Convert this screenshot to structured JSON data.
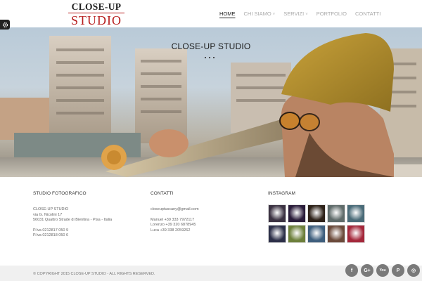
{
  "brand": {
    "logo_top": "CLOSE-UP",
    "logo_bottom": "STUDIO",
    "accent": "#b71c1c"
  },
  "nav": {
    "items": [
      {
        "label": "HOME",
        "active": true
      },
      {
        "label": "CHI SIAMO",
        "caret": "˅"
      },
      {
        "label": "SERVIZI",
        "caret": "˅"
      },
      {
        "label": "PORTFOLIO"
      },
      {
        "label": "CONTATTI"
      }
    ]
  },
  "hero": {
    "title": "CLOSE-UP STUDIO"
  },
  "footer": {
    "studio": {
      "title": "STUDIO FOTOGRAFICO",
      "lines": [
        "CLOSE-UP STUDIO",
        "via G. Nicolini 17",
        "56031 Quattro Strade di Bientina - Pisa - Italia"
      ],
      "vat": [
        "P.Iva 0212817 050 9",
        "P.Iva 0212818 050 6"
      ]
    },
    "contacts": {
      "title": "CONTATTI",
      "email": "closeuptuscany@gmail.com",
      "phones": [
        "Manuel +39 333 7972117",
        "Lorenzo +39 320 6878945",
        "Luca +39 338 2059262"
      ]
    },
    "instagram": {
      "title": "INSTAGRAM",
      "thumbs": [
        "#3b3242",
        "#2a1c3a",
        "#2e2219",
        "#5f6b6a",
        "#4a6b78",
        "#2c2f48",
        "#6c7f3a",
        "#3e5e7d",
        "#6b4a3a",
        "#a4273a"
      ]
    }
  },
  "bottom": {
    "copyright": "© COPYRIGHT 2015 CLOSE-UP STUDIO - ALL RIGHTS RESERVED.",
    "socials": [
      {
        "name": "facebook-icon",
        "glyph": "f"
      },
      {
        "name": "google-plus-icon",
        "glyph": "G+"
      },
      {
        "name": "youtube-icon",
        "glyph": "You"
      },
      {
        "name": "pinterest-icon",
        "glyph": "P"
      },
      {
        "name": "instagram-icon",
        "glyph": "◎"
      }
    ]
  }
}
